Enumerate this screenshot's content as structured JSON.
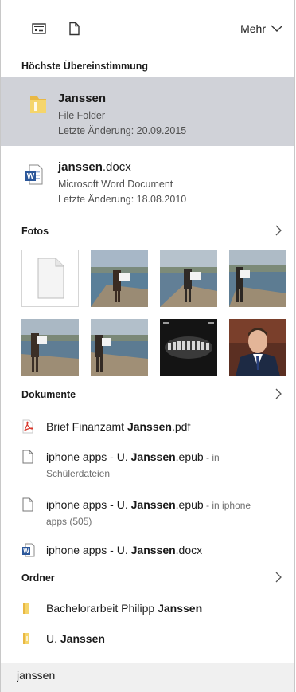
{
  "toolbar": {
    "more_label": "Mehr"
  },
  "best_match": {
    "header": "Höchste Übereinstimmung",
    "items": [
      {
        "title": "Janssen",
        "type": "File Folder",
        "modified": "Letzte Änderung: 20.09.2015"
      },
      {
        "title_bold": "janssen",
        "title_rest": ".docx",
        "type": "Microsoft Word Document",
        "modified": "Letzte Änderung: 18.08.2010"
      }
    ]
  },
  "photos": {
    "header": "Fotos"
  },
  "documents": {
    "header": "Dokumente",
    "items": [
      {
        "pre": "Brief Finanzamt ",
        "bold": "Janssen",
        "post": ".pdf",
        "location": ""
      },
      {
        "pre": "iphone apps - U. ",
        "bold": "Janssen",
        "post": ".epub",
        "location_prefix": " - in",
        "location": "Schülerdateien"
      },
      {
        "pre": "iphone apps - U. ",
        "bold": "Janssen",
        "post": ".epub",
        "location_prefix": " - in iphone",
        "location": "apps (505)"
      },
      {
        "pre": "iphone apps - U. ",
        "bold": "Janssen",
        "post": ".docx",
        "location": ""
      }
    ]
  },
  "folders": {
    "header": "Ordner",
    "items": [
      {
        "pre": "Bachelorarbeit Philipp ",
        "bold": "Janssen"
      },
      {
        "pre": "U. ",
        "bold": "Janssen"
      }
    ]
  },
  "search": {
    "value": "janssen"
  },
  "colors": {
    "selected_bg": "#d0d2d8",
    "word_blue": "#2b579a",
    "pdf_red": "#d9372b",
    "folder_yellow": "#f0c94a"
  }
}
